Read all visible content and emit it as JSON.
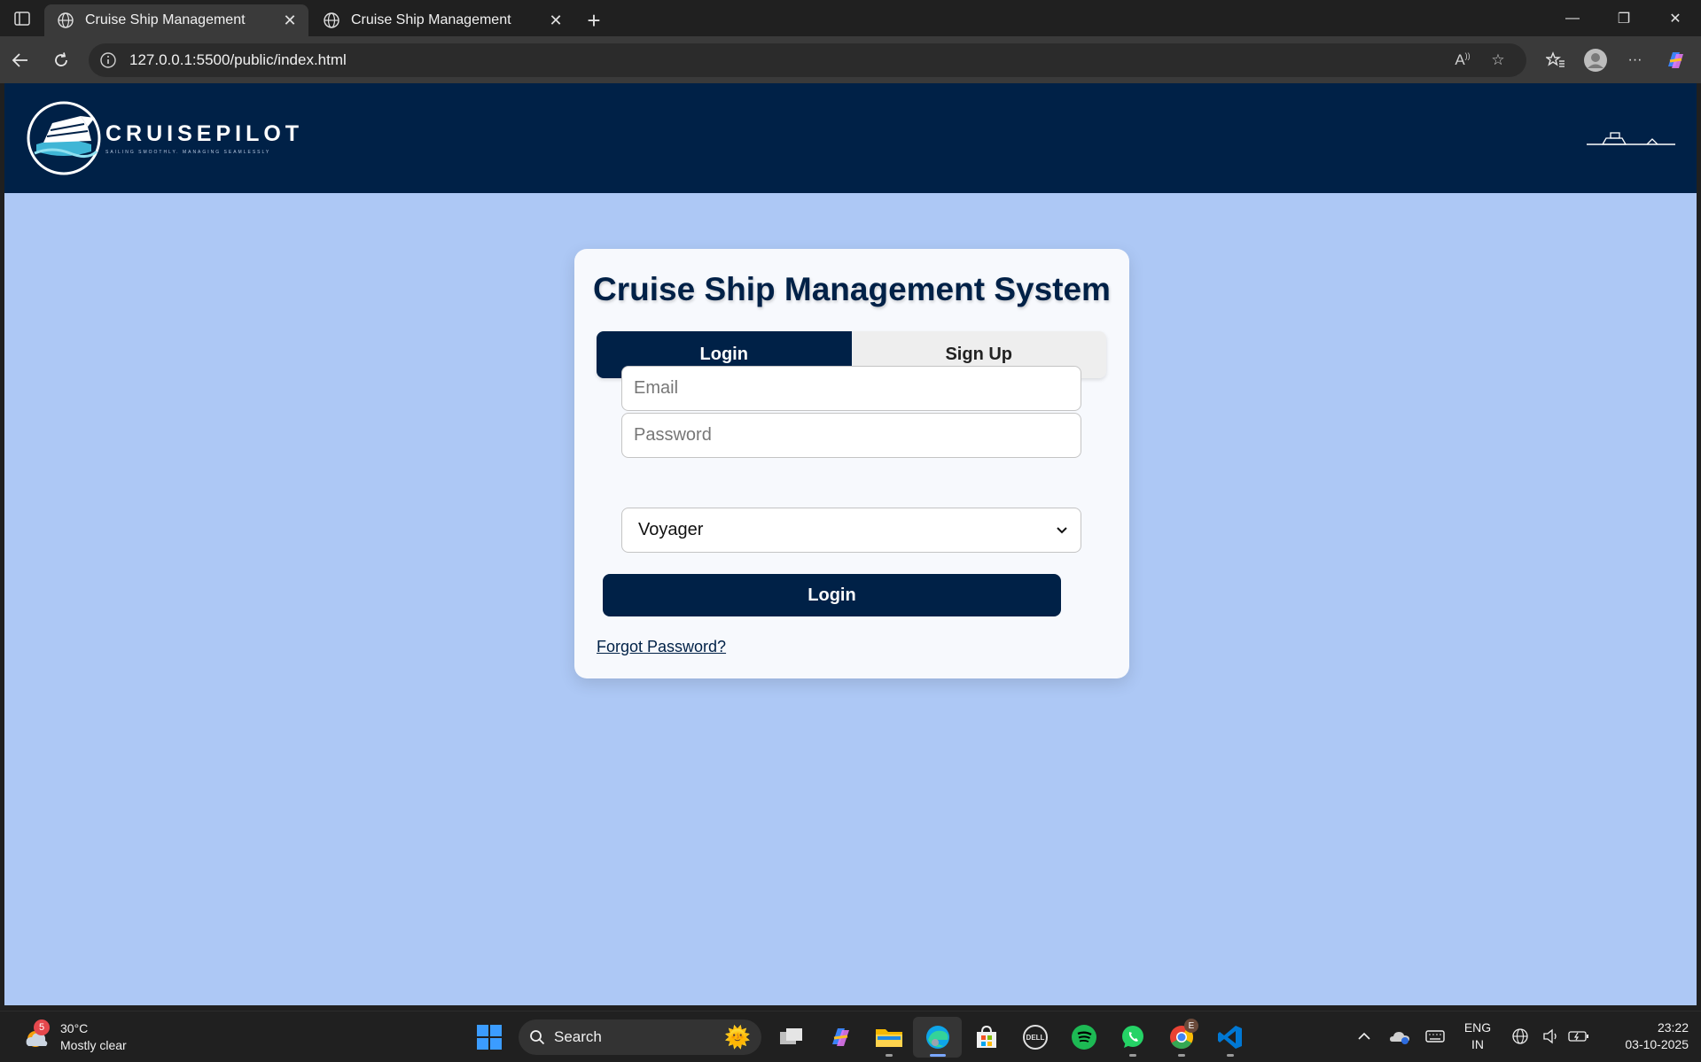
{
  "browser": {
    "tabs": [
      {
        "title": "Cruise Ship Management",
        "active": true
      },
      {
        "title": "Cruise Ship Management",
        "active": false
      }
    ],
    "url": "127.0.0.1:5500/public/index.html"
  },
  "site": {
    "brand": "CRUISEPILOT",
    "tagline": "SAILING SMOOTHLY. MANAGING SEAMLESSLY"
  },
  "auth": {
    "title": "Cruise Ship Management System",
    "tab_login": "Login",
    "tab_signup": "Sign Up",
    "email_placeholder": "Email",
    "password_placeholder": "Password",
    "role_selected": "Voyager",
    "submit_label": "Login",
    "forgot_label": "Forgot Password?"
  },
  "taskbar": {
    "weather_temp": "30°C",
    "weather_desc": "Mostly clear",
    "weather_badge": "5",
    "search_label": "Search",
    "lang_line1": "ENG",
    "lang_line2": "IN",
    "time": "23:22",
    "date": "03-10-2025",
    "chrome_badge": "E"
  },
  "colors": {
    "header_navy": "#002147",
    "page_bg": "#adc8f5",
    "card_bg": "#f7f9fd"
  }
}
